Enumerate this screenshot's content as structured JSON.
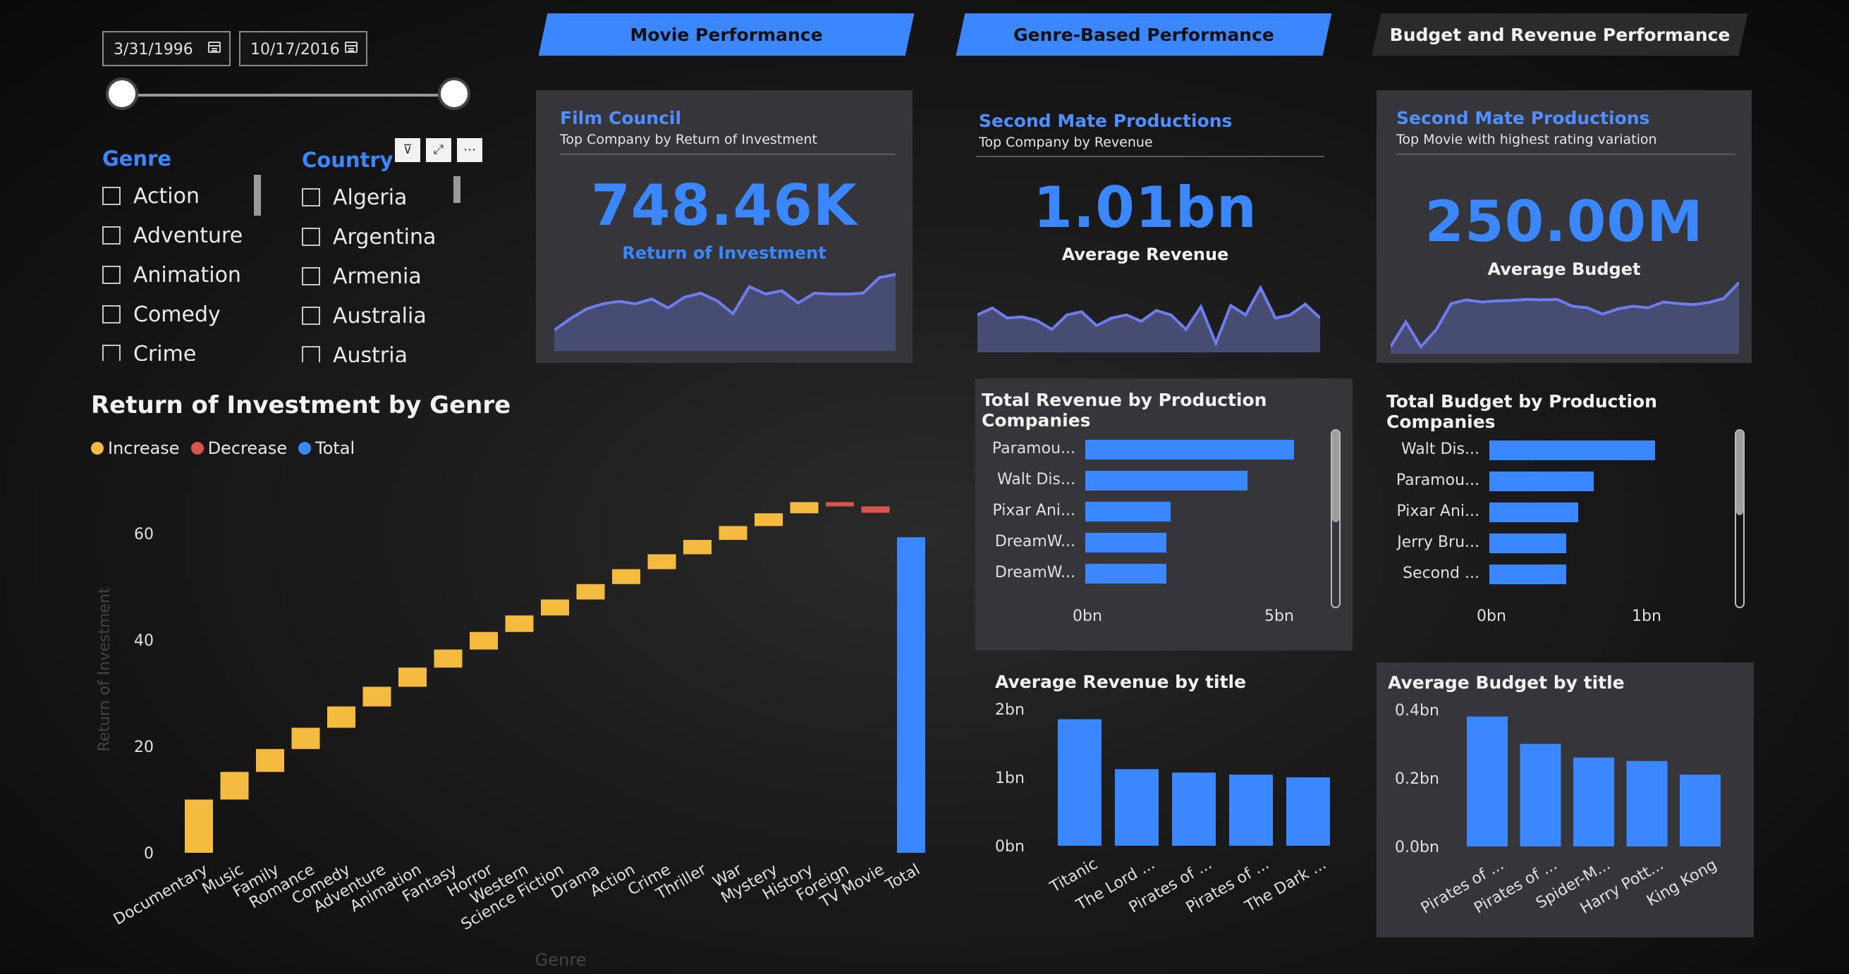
{
  "filters": {
    "start_date": "3/31/1996",
    "end_date": "10/17/2016",
    "genre": {
      "title": "Genre",
      "items": [
        "Action",
        "Adventure",
        "Animation",
        "Comedy",
        "Crime"
      ]
    },
    "country": {
      "title": "Country",
      "items": [
        "Algeria",
        "Argentina",
        "Armenia",
        "Australia",
        "Austria"
      ]
    },
    "buttons": {
      "filter": "⊽",
      "focus": "⤢",
      "more": "⋯"
    }
  },
  "tabs": [
    {
      "label": "Movie Performance",
      "active": true
    },
    {
      "label": "Genre-Based Performance",
      "active": true
    },
    {
      "label": "Budget and Revenue Performance",
      "active": false
    }
  ],
  "kpis": [
    {
      "company": "Film Council",
      "subtitle": "Top Company by Return of Investment",
      "value": "748.46K",
      "label": "Return of Investment",
      "label_color": "#3b87ff",
      "spark": [
        0.22,
        0.36,
        0.48,
        0.54,
        0.57,
        0.54,
        0.6,
        0.49,
        0.62,
        0.67,
        0.58,
        0.42,
        0.75,
        0.66,
        0.7,
        0.55,
        0.67,
        0.66,
        0.66,
        0.67,
        0.86,
        0.9
      ]
    },
    {
      "company": "Second Mate Productions",
      "subtitle": "Top Company by Revenue",
      "value": "1.01bn",
      "label": "Average Revenue",
      "label_color": "#f2f2f2",
      "spark": [
        0.55,
        0.66,
        0.5,
        0.52,
        0.46,
        0.32,
        0.55,
        0.6,
        0.38,
        0.5,
        0.55,
        0.45,
        0.62,
        0.55,
        0.32,
        0.68,
        0.1,
        0.7,
        0.55,
        0.98,
        0.5,
        0.55,
        0.72,
        0.5
      ]
    },
    {
      "company": "Second Mate Productions",
      "subtitle": "Top Movie with highest rating variation",
      "value": "250.00M",
      "label": "Average Budget",
      "label_color": "#f2f2f2",
      "spark": [
        0.08,
        0.55,
        0.08,
        0.4,
        0.9,
        0.97,
        0.93,
        0.95,
        0.96,
        0.98,
        0.97,
        0.98,
        0.85,
        0.82,
        0.7,
        0.8,
        0.85,
        0.82,
        0.93,
        0.9,
        0.88,
        0.92,
        1.0,
        1.3
      ]
    }
  ],
  "roi_chart": {
    "title": "Return of Investment by Genre",
    "legend": [
      {
        "label": "Increase",
        "color": "#f4bb40"
      },
      {
        "label": "Decrease",
        "color": "#d9534f"
      },
      {
        "label": "Total",
        "color": "#3b87ff"
      }
    ],
    "ylabel": "Return of Investment",
    "xlabel": "Genre",
    "yticks": [
      "0",
      "20",
      "40",
      "60"
    ]
  },
  "revenue_bars": {
    "title": "Total Revenue by Production Companies",
    "labels": [
      "Paramou...",
      "Walt Dis...",
      "Pixar Ani...",
      "DreamW...",
      "DreamW..."
    ],
    "ticks": [
      "0bn",
      "5bn"
    ]
  },
  "budget_bars": {
    "title": "Total Budget by Production Companies",
    "labels": [
      "Walt Dis...",
      "Paramou...",
      "Pixar Ani...",
      "Jerry Bru...",
      "Second ..."
    ],
    "ticks": [
      "0bn",
      "1bn"
    ]
  },
  "avg_revenue": {
    "title": "Average Revenue by title",
    "labels": [
      "Titanic",
      "The Lord ...",
      "Pirates of ...",
      "Pirates of ...",
      "The Dark ..."
    ],
    "yticks": [
      "2bn",
      "1bn",
      "0bn"
    ]
  },
  "avg_budget": {
    "title": "Average Budget by title",
    "labels": [
      "Pirates of ...",
      "Pirates of ...",
      "Spider-M...",
      "Harry Pott...",
      "King Kong"
    ],
    "yticks": [
      "0.4bn",
      "0.2bn",
      "0.0bn"
    ]
  },
  "chart_data": [
    {
      "type": "waterfall",
      "title": "Return of Investment by Genre",
      "xlabel": "Genre",
      "ylabel": "Return of Investment",
      "ylim": [
        0,
        64
      ],
      "categories": [
        "Documentary",
        "Music",
        "Family",
        "Romance",
        "Comedy",
        "Adventure",
        "Animation",
        "Fantasy",
        "Horror",
        "Western",
        "Science Fiction",
        "Drama",
        "Action",
        "Crime",
        "Thriller",
        "War",
        "Mystery",
        "History",
        "Foreign",
        "TV Movie",
        "Total"
      ],
      "deltas": [
        10.0,
        5.2,
        4.3,
        4.0,
        4.0,
        3.7,
        3.6,
        3.4,
        3.3,
        3.1,
        3.0,
        2.9,
        2.8,
        2.8,
        2.7,
        2.6,
        2.4,
        2.1,
        -0.8,
        -1.2,
        59.3
      ],
      "kinds": [
        "increase",
        "increase",
        "increase",
        "increase",
        "increase",
        "increase",
        "increase",
        "increase",
        "increase",
        "increase",
        "increase",
        "increase",
        "increase",
        "increase",
        "increase",
        "increase",
        "increase",
        "increase",
        "decrease",
        "decrease",
        "total"
      ]
    },
    {
      "type": "bar",
      "orientation": "horizontal",
      "title": "Total Revenue by Production Companies",
      "categories": [
        "Paramou...",
        "Walt Dis...",
        "Pixar Ani...",
        "DreamW...",
        "DreamW..."
      ],
      "values": [
        5.4,
        4.2,
        2.2,
        2.1,
        2.1
      ],
      "xlim": [
        0,
        5
      ]
    },
    {
      "type": "bar",
      "orientation": "horizontal",
      "title": "Total Budget by Production Companies",
      "categories": [
        "Walt Dis...",
        "Paramou...",
        "Pixar Ani...",
        "Jerry Bru...",
        "Second ..."
      ],
      "values": [
        1.08,
        0.68,
        0.58,
        0.5,
        0.5
      ],
      "xlim": [
        0,
        1
      ]
    },
    {
      "type": "bar",
      "title": "Average Revenue by title",
      "categories": [
        "Titanic",
        "The Lord ...",
        "Pirates of ...",
        "Pirates of ...",
        "The Dark ..."
      ],
      "values": [
        1.85,
        1.12,
        1.07,
        1.04,
        1.0
      ],
      "ylim": [
        0,
        2
      ]
    },
    {
      "type": "bar",
      "title": "Average Budget by title",
      "categories": [
        "Pirates of ...",
        "Pirates of ...",
        "Spider-M...",
        "Harry Pott...",
        "King Kong"
      ],
      "values": [
        0.38,
        0.3,
        0.26,
        0.25,
        0.21
      ],
      "ylim": [
        0,
        0.4
      ]
    }
  ]
}
